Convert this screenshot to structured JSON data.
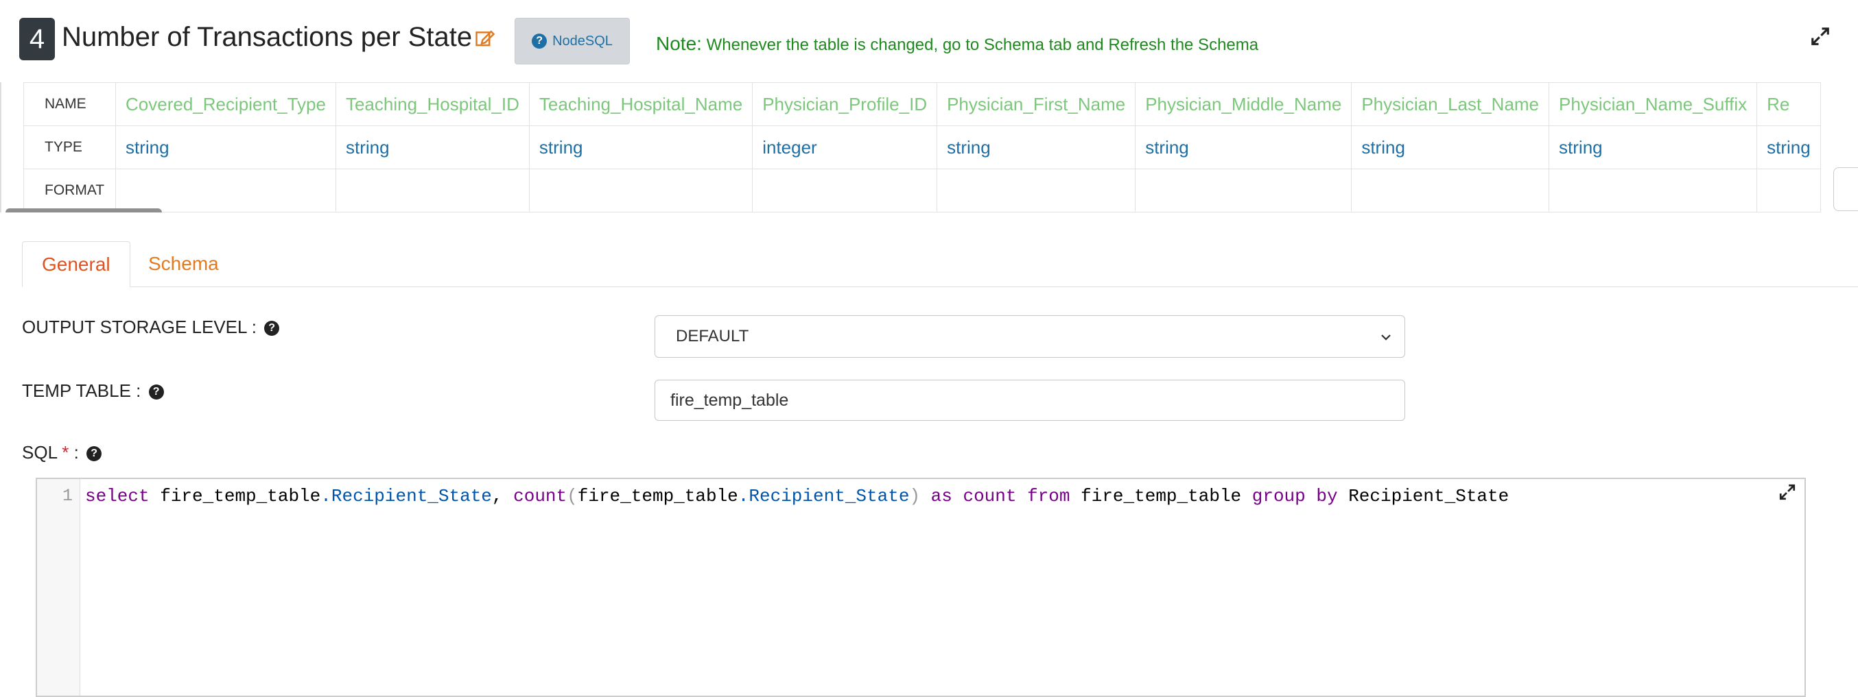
{
  "header": {
    "node_number": "4",
    "title": "Number of Transactions per State",
    "nodesql_label": "NodeSQL",
    "note_label": "Note:",
    "note_text": "Whenever the table is changed, go to Schema tab and Refresh the Schema"
  },
  "schema": {
    "row_labels": [
      "NAME",
      "TYPE",
      "FORMAT"
    ],
    "columns": [
      {
        "name": "Covered_Recipient_Type",
        "type": "string",
        "format": ""
      },
      {
        "name": "Teaching_Hospital_ID",
        "type": "string",
        "format": ""
      },
      {
        "name": "Teaching_Hospital_Name",
        "type": "string",
        "format": ""
      },
      {
        "name": "Physician_Profile_ID",
        "type": "integer",
        "format": ""
      },
      {
        "name": "Physician_First_Name",
        "type": "string",
        "format": ""
      },
      {
        "name": "Physician_Middle_Name",
        "type": "string",
        "format": ""
      },
      {
        "name": "Physician_Last_Name",
        "type": "string",
        "format": ""
      },
      {
        "name": "Physician_Name_Suffix",
        "type": "string",
        "format": ""
      },
      {
        "name": "Re",
        "type": "string",
        "format": ""
      }
    ]
  },
  "tabs": [
    {
      "label": "General",
      "active": true
    },
    {
      "label": "Schema",
      "active": false
    }
  ],
  "form": {
    "output_storage_label": "OUTPUT STORAGE LEVEL :",
    "output_storage_value": "DEFAULT",
    "temp_table_label": "TEMP TABLE :",
    "temp_table_value": "fire_temp_table",
    "sql_label": "SQL",
    "sql_required": "*",
    "sql_colon": ":"
  },
  "editor": {
    "line_number": "1",
    "tokens": [
      {
        "t": "select",
        "c": "kw"
      },
      {
        "t": " fire_temp_table",
        "c": ""
      },
      {
        "t": ".Recipient_State",
        "c": "prop"
      },
      {
        "t": ", ",
        "c": ""
      },
      {
        "t": "count",
        "c": "fn"
      },
      {
        "t": "(",
        "c": "pn"
      },
      {
        "t": "fire_temp_table",
        "c": ""
      },
      {
        "t": ".Recipient_State",
        "c": "prop"
      },
      {
        "t": ")",
        "c": "pn"
      },
      {
        "t": " as ",
        "c": "kw"
      },
      {
        "t": "count",
        "c": "fn"
      },
      {
        "t": " from ",
        "c": "kw"
      },
      {
        "t": "fire_temp_table ",
        "c": ""
      },
      {
        "t": "group",
        "c": "kw"
      },
      {
        "t": " by ",
        "c": "kw"
      },
      {
        "t": "Recipient_State",
        "c": ""
      }
    ]
  },
  "colors": {
    "accent_orange": "#e0531f",
    "note_green": "#1e8a1e",
    "column_green": "#7cc77c",
    "type_blue": "#1d6fa5"
  },
  "icons": {
    "edit": "edit-icon",
    "help": "question-circle-icon",
    "expand": "expand-icon",
    "chevron": "chevron-down-icon"
  }
}
